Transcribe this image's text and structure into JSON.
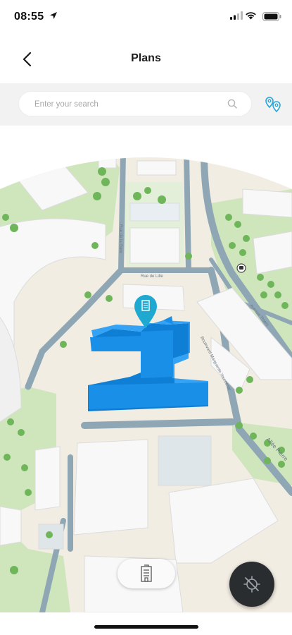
{
  "status_bar": {
    "time": "08:55"
  },
  "nav": {
    "title": "Plans"
  },
  "search": {
    "placeholder": "Enter your search",
    "value": ""
  },
  "map": {
    "street_labels": [
      "Rue de Lille",
      "Rue de la Gare",
      "Boulevard Marguerite Yourcenar",
      "Avenue Thiers",
      "Allée Pierre"
    ],
    "colors": {
      "building_highlight": "#1a8fe8",
      "marker": "#1fa9d1",
      "green": "#cfe6bd",
      "road": "#8fa7b5",
      "ground": "#f2ede3",
      "building": "#f5f5f5"
    }
  },
  "icons": {
    "back": "chevron-left-icon",
    "search": "search-icon",
    "pins": "location-pins-icon",
    "floor": "building-icon",
    "locate": "location-off-icon"
  }
}
